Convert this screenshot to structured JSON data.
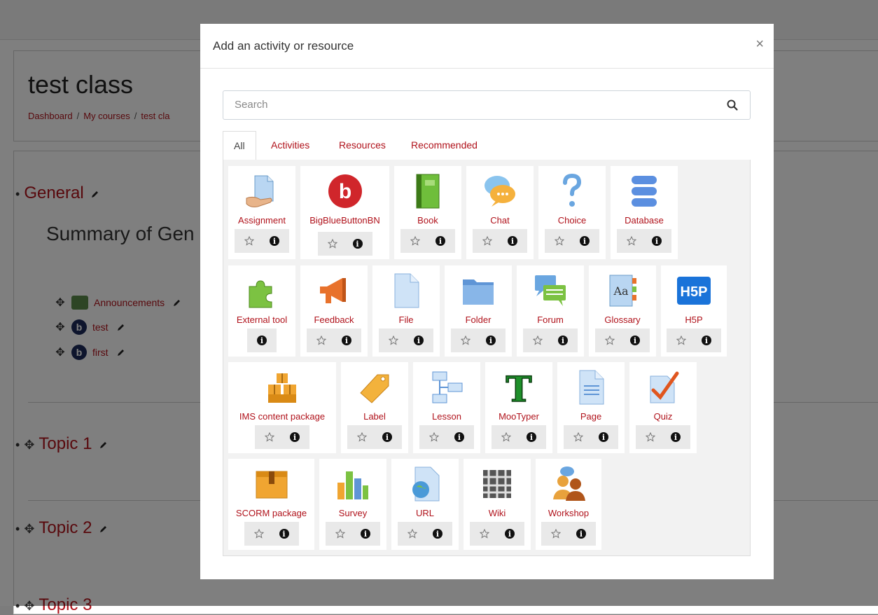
{
  "course": {
    "title": "test class",
    "breadcrumb": [
      "Dashboard",
      "My courses",
      "test cla"
    ]
  },
  "sections": {
    "general": "General",
    "summary": "Summary of Gen",
    "activities": [
      "Announcements",
      "test",
      "first"
    ],
    "topic1": "Topic 1",
    "topic2": "Topic 2",
    "topic3": "Topic 3"
  },
  "modal": {
    "title": "Add an activity or resource",
    "close": "×",
    "search_placeholder": "Search",
    "tabs": [
      "All",
      "Activities",
      "Resources",
      "Recommended"
    ],
    "active_tab": "All",
    "items": [
      {
        "label": "Assignment",
        "icon": "assignment-icon"
      },
      {
        "label": "BigBlueButtonBN",
        "icon": "bigbluebutton-icon"
      },
      {
        "label": "Book",
        "icon": "book-icon"
      },
      {
        "label": "Chat",
        "icon": "chat-icon"
      },
      {
        "label": "Choice",
        "icon": "choice-icon"
      },
      {
        "label": "Database",
        "icon": "database-icon"
      },
      {
        "label": "External tool",
        "icon": "external-tool-icon"
      },
      {
        "label": "Feedback",
        "icon": "feedback-icon"
      },
      {
        "label": "File",
        "icon": "file-icon"
      },
      {
        "label": "Folder",
        "icon": "folder-icon"
      },
      {
        "label": "Forum",
        "icon": "forum-icon"
      },
      {
        "label": "Glossary",
        "icon": "glossary-icon"
      },
      {
        "label": "H5P",
        "icon": "h5p-icon"
      },
      {
        "label": "IMS content package",
        "icon": "ims-package-icon"
      },
      {
        "label": "Label",
        "icon": "label-icon"
      },
      {
        "label": "Lesson",
        "icon": "lesson-icon"
      },
      {
        "label": "MooTyper",
        "icon": "mootyper-icon"
      },
      {
        "label": "Page",
        "icon": "page-icon"
      },
      {
        "label": "Quiz",
        "icon": "quiz-icon"
      },
      {
        "label": "SCORM package",
        "icon": "scorm-icon"
      },
      {
        "label": "Survey",
        "icon": "survey-icon"
      },
      {
        "label": "URL",
        "icon": "url-icon"
      },
      {
        "label": "Wiki",
        "icon": "wiki-icon"
      },
      {
        "label": "Workshop",
        "icon": "workshop-icon"
      }
    ],
    "h5p_text": "H5P",
    "mootyper_glyph": "T",
    "bbb_glyph": "b"
  },
  "colors": {
    "link": "#b0121b",
    "overlay": "rgba(0,0,0,0.5)"
  }
}
